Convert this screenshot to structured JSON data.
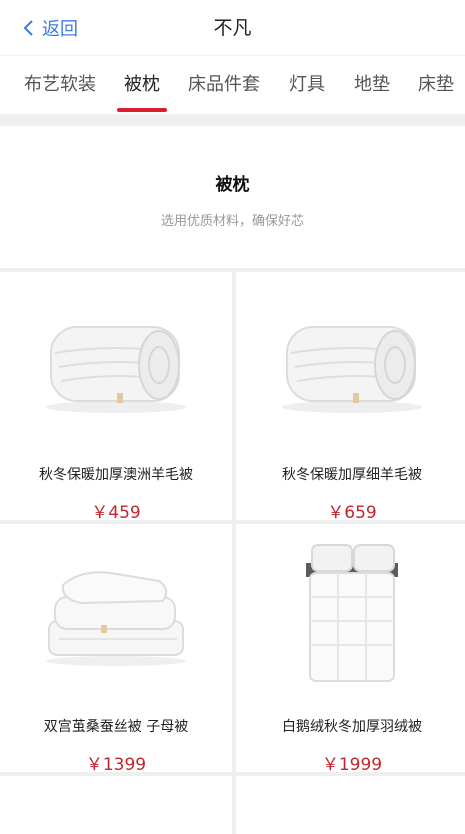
{
  "nav": {
    "back_label": "返回",
    "title": "不凡"
  },
  "tabs": [
    {
      "label": "布艺软装",
      "active": false
    },
    {
      "label": "被枕",
      "active": true
    },
    {
      "label": "床品件套",
      "active": false
    },
    {
      "label": "灯具",
      "active": false
    },
    {
      "label": "地垫",
      "active": false
    },
    {
      "label": "床垫",
      "active": false
    }
  ],
  "section": {
    "title": "被枕",
    "subtitle": "选用优质材料，确保好芯"
  },
  "products": [
    {
      "name": "秋冬保暖加厚澳洲羊毛被",
      "price": "￥459",
      "image": "folded-quilt-image"
    },
    {
      "name": "秋冬保暖加厚细羊毛被",
      "price": "￥659",
      "image": "folded-quilt-image"
    },
    {
      "name": "双宫茧桑蚕丝被 子母被",
      "price": "￥1399",
      "image": "stacked-silk-quilt-image"
    },
    {
      "name": "白鹅绒秋冬加厚羽绒被",
      "price": "￥1999",
      "image": "bed-duvet-image"
    }
  ],
  "colors": {
    "accent": "#3c7de0",
    "active_tab_underline": "#d81f2c",
    "price": "#c0262e"
  }
}
